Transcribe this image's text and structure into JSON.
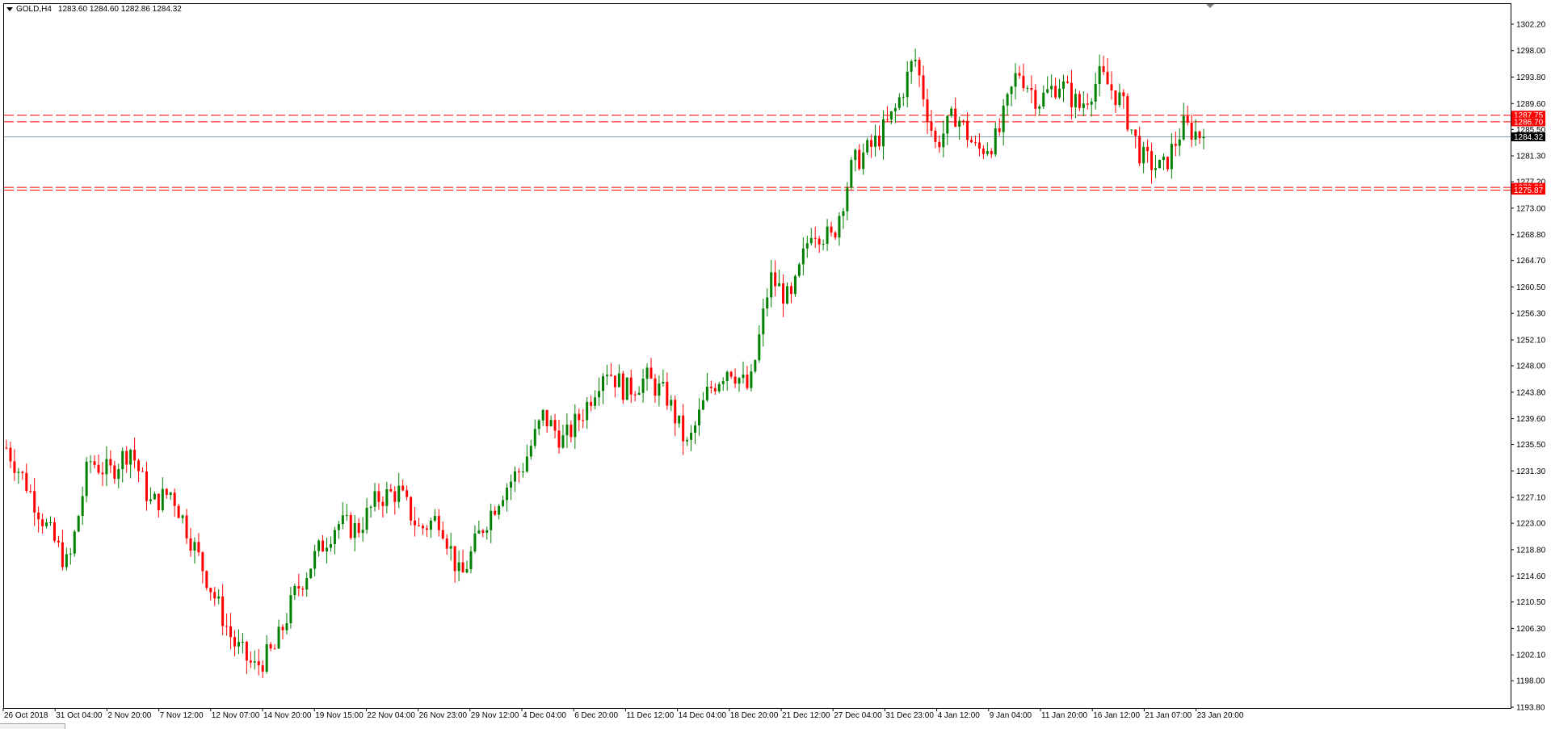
{
  "header": {
    "symbol": "GOLD,H4",
    "ohlc": "1283.60 1284.60 1282.86 1284.32"
  },
  "chart_data": {
    "type": "candlestick",
    "title": "GOLD,H4",
    "y_axis": {
      "ylim": [
        1193.8,
        1304.5
      ],
      "ticks": [
        1302.2,
        1298.0,
        1293.8,
        1289.6,
        1285.5,
        1281.3,
        1277.2,
        1273.0,
        1268.8,
        1264.7,
        1260.5,
        1256.3,
        1252.1,
        1248.0,
        1243.8,
        1239.6,
        1235.5,
        1231.3,
        1227.1,
        1223.0,
        1218.8,
        1214.6,
        1210.5,
        1206.3,
        1202.1,
        1198.0,
        1193.8
      ]
    },
    "x_axis": {
      "labels": [
        "26 Oct 2018",
        "31 Oct 04:00",
        "2 Nov 20:00",
        "7 Nov 12:00",
        "12 Nov 07:00",
        "14 Nov 20:00",
        "19 Nov 15:00",
        "22 Nov 04:00",
        "26 Nov 23:00",
        "29 Nov 12:00",
        "4 Dec 04:00",
        "6 Dec 20:00",
        "11 Dec 12:00",
        "14 Dec 04:00",
        "18 Dec 20:00",
        "21 Dec 12:00",
        "27 Dec 04:00",
        "31 Dec 23:00",
        "4 Jan 12:00",
        "9 Jan 04:00",
        "11 Jan 20:00",
        "16 Jan 12:00",
        "21 Jan 07:00",
        "23 Jan 20:00"
      ]
    },
    "anchors": [
      1235.0,
      1229.0,
      1222.0,
      1216.0,
      1233.0,
      1231.0,
      1235.0,
      1226.0,
      1228.0,
      1220.0,
      1212.0,
      1204.0,
      1200.0,
      1203.0,
      1212.0,
      1218.0,
      1223.0,
      1222.0,
      1227.0,
      1228.0,
      1222.0,
      1224.0,
      1214.0,
      1222.0,
      1228.0,
      1232.0,
      1240.0,
      1236.0,
      1241.0,
      1248.0,
      1244.0,
      1246.0,
      1243.0,
      1235.0,
      1244.0,
      1248.0,
      1244.0,
      1262.0,
      1258.0,
      1270.0,
      1268.0,
      1280.0,
      1283.0,
      1288.0,
      1297.0,
      1283.0,
      1288.0,
      1282.0,
      1284.0,
      1295.0,
      1290.0,
      1293.0,
      1289.0,
      1294.0,
      1290.0,
      1281.0,
      1279.0,
      1286.0,
      1284.32
    ],
    "candle_count": 300,
    "last_price": "1284.32",
    "price_lines": [
      {
        "label": "1287.75",
        "value": 1287.75,
        "style": "dashed",
        "color": "#ff0000"
      },
      {
        "label": "1286.70",
        "value": 1286.7,
        "style": "dashed",
        "color": "#ff0000"
      },
      {
        "label": "1276.30",
        "value": 1276.3,
        "style": "dashed",
        "color": "#ff0000"
      },
      {
        "label": "1275.87",
        "value": 1275.87,
        "style": "dashed",
        "color": "#ff0000"
      }
    ],
    "current_price_line": {
      "label": "1284.32",
      "value": 1284.32,
      "color": "#7f9db9"
    },
    "colors": {
      "bull": "#008000",
      "bear": "#ff0000",
      "axis": "#000000",
      "level_badge": "#ff0000",
      "price_badge": "#000000"
    },
    "grid": false
  }
}
